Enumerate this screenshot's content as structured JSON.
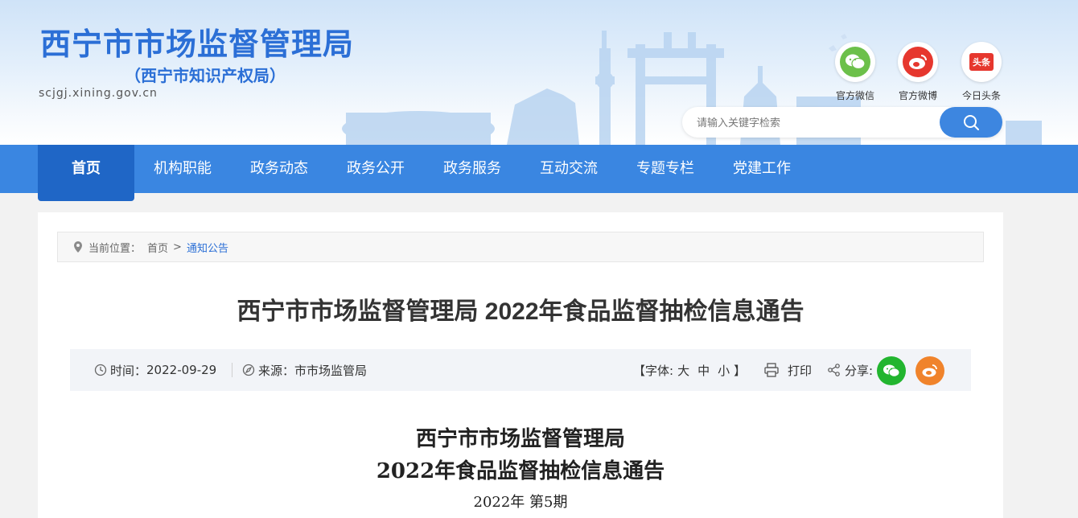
{
  "header": {
    "title": "西宁市市场监督管理局",
    "subtitle": "（西宁市知识产权局）",
    "domain": "scjgj.xining.gov.cn",
    "social": [
      {
        "label": "官方微信",
        "icon": "wechat-icon"
      },
      {
        "label": "官方微博",
        "icon": "weibo-icon"
      },
      {
        "label": "今日头条",
        "icon": "toutiao-icon",
        "badge": "头条"
      }
    ],
    "search": {
      "placeholder": "请输入关键字检索"
    }
  },
  "nav": {
    "items": [
      "首页",
      "机构职能",
      "政务动态",
      "政务公开",
      "政务服务",
      "互动交流",
      "专题专栏",
      "党建工作"
    ],
    "active": "首页"
  },
  "breadcrumb": {
    "prefix": "当前位置：",
    "home": "首页",
    "separator": ">",
    "current": "通知公告"
  },
  "article": {
    "title": "西宁市市场监督管理局 2022年食品监督抽检信息通告",
    "time_label": "时间：",
    "time": "2022-09-29",
    "source_label": "来源：",
    "source": "市市场监管局",
    "font_open": "【字体:",
    "font_large": "大",
    "font_medium": "中",
    "font_small": "小",
    "font_close": "】",
    "print": "打印",
    "share": "分享:",
    "doc_line1": "西宁市市场监督管理局",
    "doc_line2": "2022年食品监督抽检信息通告",
    "issue": "2022年 第5期"
  },
  "colors": {
    "brand": "#2b6fd6",
    "nav": "#3a86e1",
    "nav_active": "#1f66c6",
    "wechat": "#22b52f",
    "weibo": "#f0832b"
  }
}
